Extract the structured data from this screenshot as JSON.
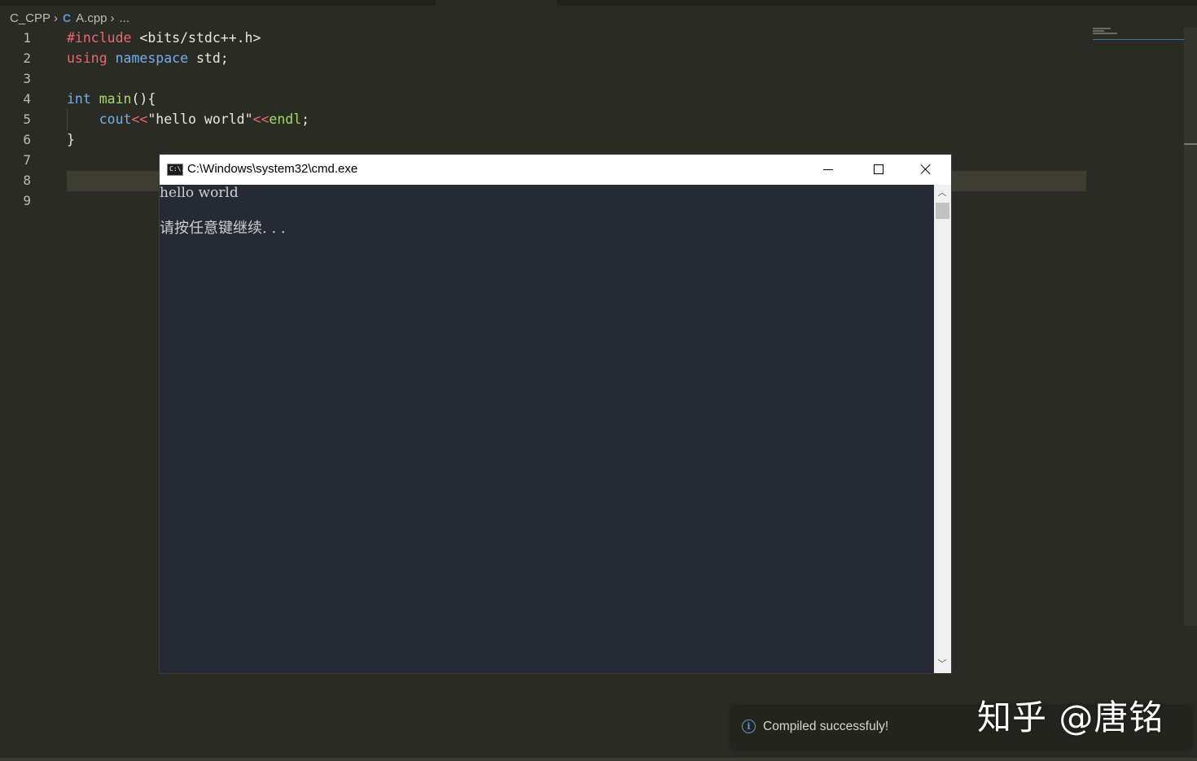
{
  "breadcrumb": {
    "folder": "C_CPP",
    "file_icon": "cpp-file-icon",
    "file": "A.cpp",
    "more": "..."
  },
  "editor": {
    "line_numbers": [
      "1",
      "2",
      "3",
      "4",
      "5",
      "6",
      "7",
      "8",
      "9"
    ],
    "lines": [
      {
        "tokens": [
          {
            "t": "#include",
            "c": "kw-red"
          },
          {
            "t": " <bits/stdc++.h>",
            "c": ""
          }
        ]
      },
      {
        "tokens": [
          {
            "t": "using",
            "c": "kw-red"
          },
          {
            "t": " ",
            "c": ""
          },
          {
            "t": "namespace",
            "c": "kw-blue"
          },
          {
            "t": " std;",
            "c": ""
          }
        ]
      },
      {
        "tokens": []
      },
      {
        "tokens": [
          {
            "t": "int",
            "c": "kw-blue"
          },
          {
            "t": " ",
            "c": ""
          },
          {
            "t": "main",
            "c": "fn-green"
          },
          {
            "t": "(){",
            "c": ""
          }
        ]
      },
      {
        "tokens": [
          {
            "t": "    ",
            "c": ""
          },
          {
            "t": "cout",
            "c": "kw-blue"
          },
          {
            "t": "<<",
            "c": "kw-red"
          },
          {
            "t": "\"hello world\"",
            "c": "str"
          },
          {
            "t": "<<",
            "c": "kw-red"
          },
          {
            "t": "endl",
            "c": "fn-green"
          },
          {
            "t": ";",
            "c": ""
          }
        ]
      },
      {
        "tokens": [
          {
            "t": "}",
            "c": ""
          }
        ]
      },
      {
        "tokens": []
      },
      {
        "tokens": []
      },
      {
        "tokens": []
      }
    ]
  },
  "cmd_window": {
    "title": "C:\\Windows\\system32\\cmd.exe",
    "icon_text": "C:\\.",
    "output_line1": "hello world",
    "output_line2": "请按任意键继续. . ."
  },
  "notification": {
    "icon": "info-icon",
    "text": "Compiled successfuly!"
  },
  "watermark": "知乎 @唐铭"
}
